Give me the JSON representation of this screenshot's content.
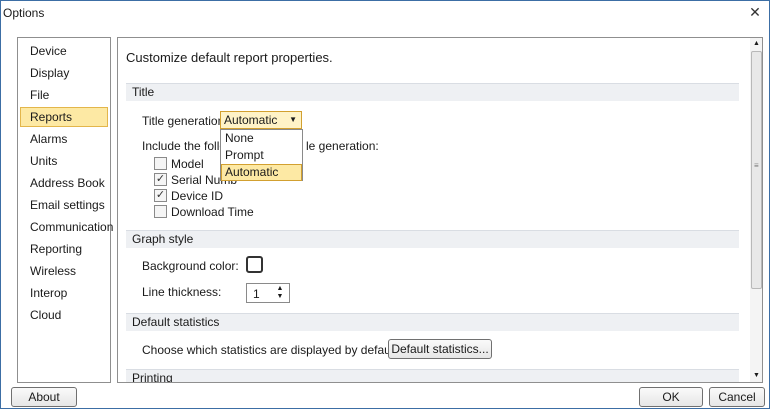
{
  "window": {
    "title": "Options",
    "close_glyph": "✕"
  },
  "sidebar": {
    "items": [
      {
        "label": "Device",
        "selected": false
      },
      {
        "label": "Display",
        "selected": false
      },
      {
        "label": "File",
        "selected": false
      },
      {
        "label": "Reports",
        "selected": true
      },
      {
        "label": "Alarms",
        "selected": false
      },
      {
        "label": "Units",
        "selected": false
      },
      {
        "label": "Address Book",
        "selected": false
      },
      {
        "label": "Email settings",
        "selected": false
      },
      {
        "label": "Communication",
        "selected": false
      },
      {
        "label": "Reporting",
        "selected": false
      },
      {
        "label": "Wireless",
        "selected": false
      },
      {
        "label": "Interop",
        "selected": false
      },
      {
        "label": "Cloud",
        "selected": false
      }
    ]
  },
  "content": {
    "header": "Customize default report properties.",
    "title_section": {
      "heading": "Title",
      "title_generation_label": "Title generation:",
      "title_generation_value": "Automatic",
      "include_label_left": "Include the follow",
      "include_label_right": "le generation:",
      "checkboxes": [
        {
          "label": "Model",
          "checked": false
        },
        {
          "label": "Serial Numb",
          "checked": true
        },
        {
          "label": "Device ID",
          "checked": true
        },
        {
          "label": "Download Time",
          "checked": false
        }
      ],
      "dropdown_options": [
        {
          "label": "None",
          "selected": false
        },
        {
          "label": "Prompt",
          "selected": false
        },
        {
          "label": "Automatic",
          "selected": true
        }
      ]
    },
    "graph_section": {
      "heading": "Graph style",
      "background_color_label": "Background color:",
      "background_color": "#ffffff",
      "line_thickness_label": "Line thickness:",
      "line_thickness_value": "1"
    },
    "stats_section": {
      "heading": "Default statistics",
      "description": "Choose which statistics are displayed by default:",
      "button_label": "Default statistics..."
    },
    "printing_section": {
      "heading": "Printing"
    }
  },
  "footer": {
    "about_label": "About",
    "ok_label": "OK",
    "cancel_label": "Cancel"
  },
  "icons": {
    "check": "✓",
    "dropdown_arrow": "▼",
    "spin_up": "▲",
    "spin_down": "▼",
    "scroll_up": "▲",
    "scroll_down": "▼",
    "grip": "≡"
  },
  "colors": {
    "selection_fill": "#fde9a4",
    "selection_border": "#e3b64b",
    "window_border": "#3c6ea5"
  }
}
